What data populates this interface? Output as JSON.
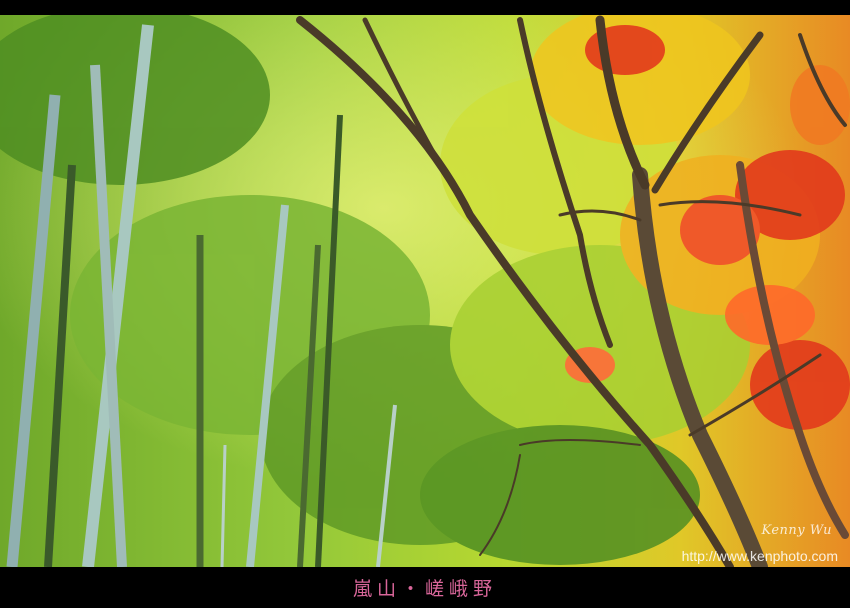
{
  "photo": {
    "subject": "bamboo forest with autumn maple trees",
    "colors": {
      "bamboo_green": "#8fc23a",
      "foliage_yellow": "#e8d020",
      "maple_red": "#e23a1c",
      "border": "#000000"
    }
  },
  "signature": "Kenny Wu",
  "watermark": "http://www.kenphoto.com",
  "caption": "嵐山・嵯峨野"
}
